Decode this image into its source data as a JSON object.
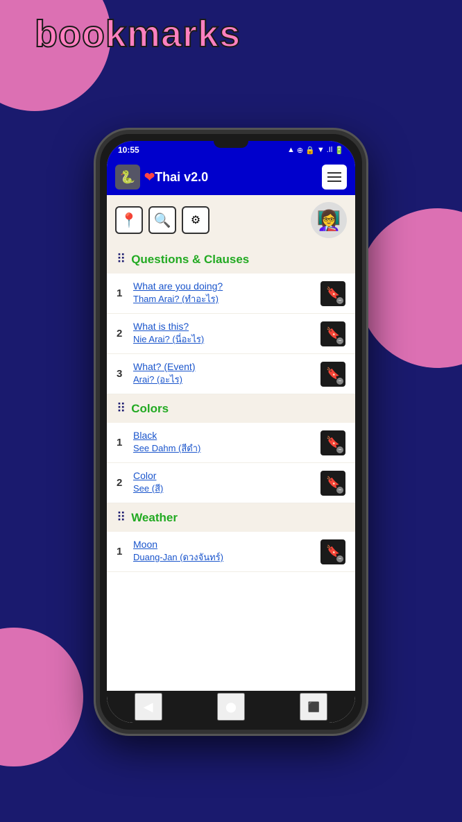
{
  "page": {
    "title": "bookmarks"
  },
  "statusBar": {
    "time": "10:55",
    "icons": "▲ ⊕ 🔒 ▼▲ .Il 🔋"
  },
  "appBar": {
    "logoEmoji": "🐍",
    "titlePrefix": "❤",
    "titleMain": "Thai v2.0",
    "menuLabel": "≡"
  },
  "toolbar": {
    "icons": [
      "📍",
      "🔍",
      "⚙"
    ],
    "avatarEmoji": "👩‍🏫"
  },
  "sections": [
    {
      "id": "questions",
      "title": "Questions & Clauses",
      "items": [
        {
          "number": "1",
          "main": "What are you doing?",
          "sub": "Tham Arai? (ทำอะไร)"
        },
        {
          "number": "2",
          "main": "What is this?",
          "sub": "Nie Arai? (นี่อะไร)"
        },
        {
          "number": "3",
          "main": "What? (Event)",
          "sub": "Arai? (อะไร)"
        }
      ]
    },
    {
      "id": "colors",
      "title": "Colors",
      "items": [
        {
          "number": "1",
          "main": "Black",
          "sub": "See Dahm (สีดำ)"
        },
        {
          "number": "2",
          "main": "Color",
          "sub": "See (สี)"
        }
      ]
    },
    {
      "id": "weather",
      "title": "Weather",
      "items": [
        {
          "number": "1",
          "main": "Moon",
          "sub": "Duang-Jan (ดวงจันทร์)"
        }
      ]
    }
  ],
  "bottomNav": {
    "back": "◀",
    "home": "⬤",
    "square": "⬛"
  }
}
